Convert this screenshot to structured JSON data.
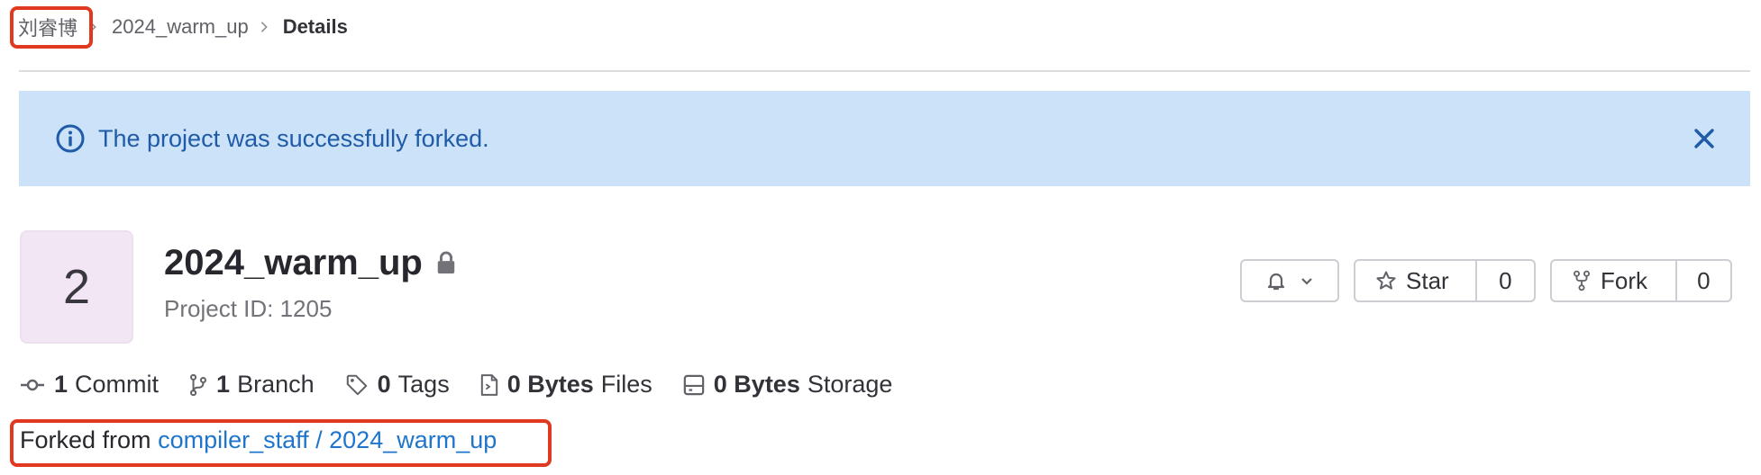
{
  "breadcrumb": {
    "items": [
      "刘睿博",
      "2024_warm_up",
      "Details"
    ]
  },
  "alert": {
    "message": "The project was successfully forked.",
    "icon": "info-circle-icon",
    "close_icon": "close-icon"
  },
  "project": {
    "avatar_letter": "2",
    "name": "2024_warm_up",
    "visibility_icon": "lock-icon",
    "project_id_label": "Project ID: 1205"
  },
  "actions": {
    "notifications_icon": "bell-icon",
    "star_label": "Star",
    "star_count": "0",
    "fork_label": "Fork",
    "fork_count": "0"
  },
  "stats": [
    {
      "icon": "commit-icon",
      "count": "1",
      "label": "Commit"
    },
    {
      "icon": "branch-icon",
      "count": "1",
      "label": "Branch"
    },
    {
      "icon": "tag-icon",
      "count": "0",
      "label": "Tags"
    },
    {
      "icon": "file-icon",
      "count": "0 Bytes",
      "label": "Files"
    },
    {
      "icon": "storage-icon",
      "count": "0 Bytes",
      "label": "Storage"
    }
  ],
  "forked_from": {
    "prefix": "Forked from",
    "link_text": "compiler_staff / 2024_warm_up"
  },
  "colors": {
    "alert_bg": "#cbe2f9",
    "alert_text": "#1f5ba8",
    "link": "#1f75cb",
    "highlight": "#e1391f",
    "avatar_bg": "#f3e6f4"
  }
}
